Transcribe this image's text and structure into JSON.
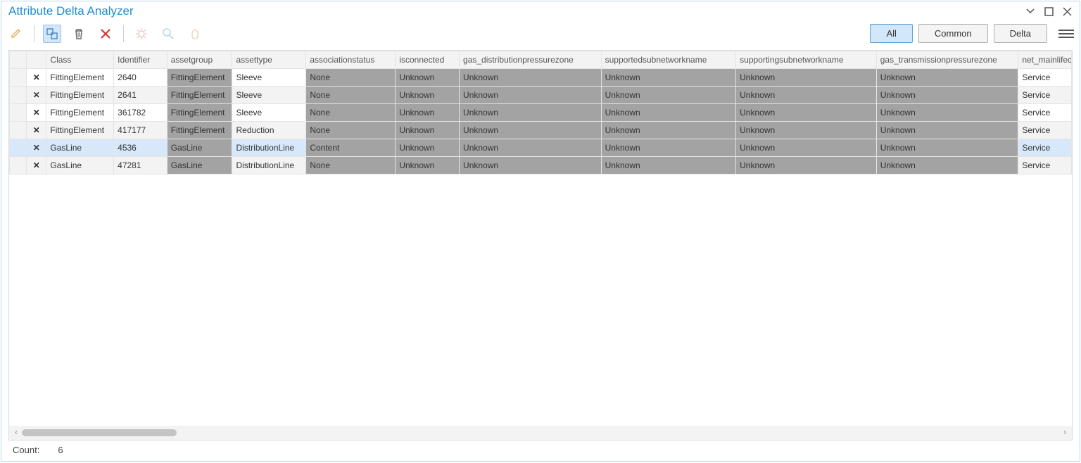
{
  "window": {
    "title": "Attribute Delta Analyzer"
  },
  "toolbar": {
    "buttons": {
      "all": "All",
      "common": "Common",
      "delta": "Delta"
    }
  },
  "table": {
    "columns": [
      {
        "key": "class",
        "label": "Class"
      },
      {
        "key": "identifier",
        "label": "Identifier"
      },
      {
        "key": "assetgroup",
        "label": "assetgroup"
      },
      {
        "key": "assettype",
        "label": "assettype"
      },
      {
        "key": "associationstatus",
        "label": "associationstatus"
      },
      {
        "key": "isconnected",
        "label": "isconnected"
      },
      {
        "key": "gas_distributionpressurezone",
        "label": "gas_distributionpressurezone"
      },
      {
        "key": "supportedsubnetworkname",
        "label": "supportedsubnetworkname"
      },
      {
        "key": "supportingsubnetworkname",
        "label": "supportingsubnetworkname"
      },
      {
        "key": "gas_transmissionpressurezone",
        "label": "gas_transmissionpressurezone"
      },
      {
        "key": "net_mainlifec",
        "label": "net_mainlifec"
      }
    ],
    "rows": [
      {
        "class": "FittingElement",
        "identifier": "2640",
        "assetgroup": "FittingElement",
        "assettype": "Sleeve",
        "associationstatus": "None",
        "isconnected": "Unknown",
        "gas_distributionpressurezone": "Unknown",
        "supportedsubnetworkname": "Unknown",
        "supportingsubnetworkname": "Unknown",
        "gas_transmissionpressurezone": "Unknown",
        "net_mainlifec": "Service",
        "alt": false,
        "selected": false
      },
      {
        "class": "FittingElement",
        "identifier": "2641",
        "assetgroup": "FittingElement",
        "assettype": "Sleeve",
        "associationstatus": "None",
        "isconnected": "Unknown",
        "gas_distributionpressurezone": "Unknown",
        "supportedsubnetworkname": "Unknown",
        "supportingsubnetworkname": "Unknown",
        "gas_transmissionpressurezone": "Unknown",
        "net_mainlifec": "Service",
        "alt": true,
        "selected": false
      },
      {
        "class": "FittingElement",
        "identifier": "361782",
        "assetgroup": "FittingElement",
        "assettype": "Sleeve",
        "associationstatus": "None",
        "isconnected": "Unknown",
        "gas_distributionpressurezone": "Unknown",
        "supportedsubnetworkname": "Unknown",
        "supportingsubnetworkname": "Unknown",
        "gas_transmissionpressurezone": "Unknown",
        "net_mainlifec": "Service",
        "alt": false,
        "selected": false
      },
      {
        "class": "FittingElement",
        "identifier": "417177",
        "assetgroup": "FittingElement",
        "assettype": "Reduction",
        "associationstatus": "None",
        "isconnected": "Unknown",
        "gas_distributionpressurezone": "Unknown",
        "supportedsubnetworkname": "Unknown",
        "supportingsubnetworkname": "Unknown",
        "gas_transmissionpressurezone": "Unknown",
        "net_mainlifec": "Service",
        "alt": true,
        "selected": false
      },
      {
        "class": "GasLine",
        "identifier": "4536",
        "assetgroup": "GasLine",
        "assettype": "DistributionLine",
        "associationstatus": "Content",
        "isconnected": "Unknown",
        "gas_distributionpressurezone": "Unknown",
        "supportedsubnetworkname": "Unknown",
        "supportingsubnetworkname": "Unknown",
        "gas_transmissionpressurezone": "Unknown",
        "net_mainlifec": "Service",
        "alt": false,
        "selected": true
      },
      {
        "class": "GasLine",
        "identifier": "47281",
        "assetgroup": "GasLine",
        "assettype": "DistributionLine",
        "associationstatus": "None",
        "isconnected": "Unknown",
        "gas_distributionpressurezone": "Unknown",
        "supportedsubnetworkname": "Unknown",
        "supportingsubnetworkname": "Unknown",
        "gas_transmissionpressurezone": "Unknown",
        "net_mainlifec": "Service",
        "alt": true,
        "selected": false
      }
    ],
    "shadedCols": [
      "assetgroup",
      "associationstatus",
      "isconnected",
      "gas_distributionpressurezone",
      "supportedsubnetworkname",
      "supportingsubnetworkname",
      "gas_transmissionpressurezone"
    ]
  },
  "status": {
    "count_label": "Count:",
    "count_value": "6"
  }
}
